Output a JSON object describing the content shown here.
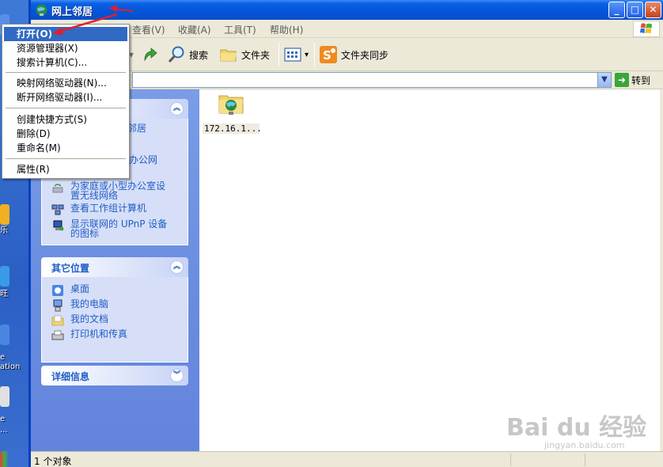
{
  "window": {
    "title": "网上邻居",
    "minimize": "_",
    "maximize": "□",
    "close": "✕"
  },
  "menubar": {
    "view": "查看(V)",
    "favorites": "收藏(A)",
    "tools": "工具(T)",
    "help": "帮助(H)"
  },
  "toolbar": {
    "search": "搜索",
    "folders": "文件夹",
    "view_dropdown": "▾",
    "folder_sync": "文件夹同步"
  },
  "address": {
    "value": "",
    "go": "转到"
  },
  "context_menu": {
    "items": [
      "打开(O)",
      "资源管理器(X)",
      "搜索计算机(C)...",
      "映射网络驱动器(N)...",
      "断开网络驱动器(I)...",
      "创建快捷方式(S)",
      "删除(D)",
      "重命名(M)",
      "属性(R)"
    ]
  },
  "taskpane": {
    "network_tasks": {
      "partial_1": "邻居",
      "partial_2": "型办公网",
      "wireless": "为家庭或小型办公室设置无线网络",
      "workgroup": "查看工作组计算机",
      "upnp": "显示联网的 UPnP 设备的图标"
    },
    "other_places": {
      "title": "其它位置",
      "items": [
        "桌面",
        "我的电脑",
        "我的文档",
        "打印机和传真"
      ]
    },
    "details": {
      "title": "详细信息"
    }
  },
  "content": {
    "items": [
      {
        "label": "172.16.1..."
      }
    ]
  },
  "statusbar": {
    "text": "1 个对象"
  },
  "desktop": {
    "labels": [
      "乐",
      "旺",
      "e",
      "ation",
      "e",
      "..."
    ]
  },
  "watermark": {
    "main": "Bai du 经验",
    "sub": "jingyan.baidu.com"
  }
}
